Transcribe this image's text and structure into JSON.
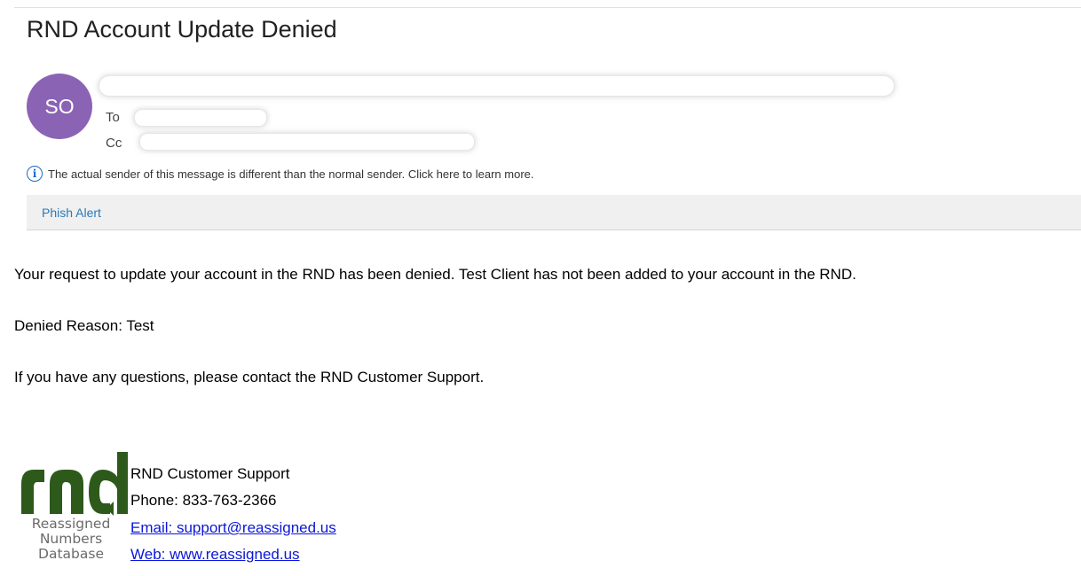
{
  "subject": "RND Account Update Denied",
  "sender": {
    "initials": "SO",
    "to_label": "To",
    "cc_label": "Cc"
  },
  "notice": {
    "icon": "info-icon",
    "text": "The actual sender of this message is different than the normal sender. Click here to learn more."
  },
  "phish_alert": {
    "label": "Phish Alert"
  },
  "body": {
    "paragraph1": "Your request to update your account in the RND has been denied. Test Client has not been added to your account in the RND.",
    "paragraph2": "Denied Reason: Test",
    "paragraph3": "If you have any questions, please contact the RND Customer Support."
  },
  "signature": {
    "logo_text": "rnd",
    "logo_line1": "Reassigned",
    "logo_line2": "Numbers",
    "logo_line3": "Database",
    "name": "RND Customer Support",
    "phone": "Phone: 833-763-2366",
    "email": "Email: support@reassigned.us",
    "web": "Web: www.reassigned.us"
  },
  "colors": {
    "avatar": "#8b63b5",
    "link": "#0b17d8",
    "phish_link": "#2a7ab7",
    "logo_green": "#2d5a1b"
  }
}
